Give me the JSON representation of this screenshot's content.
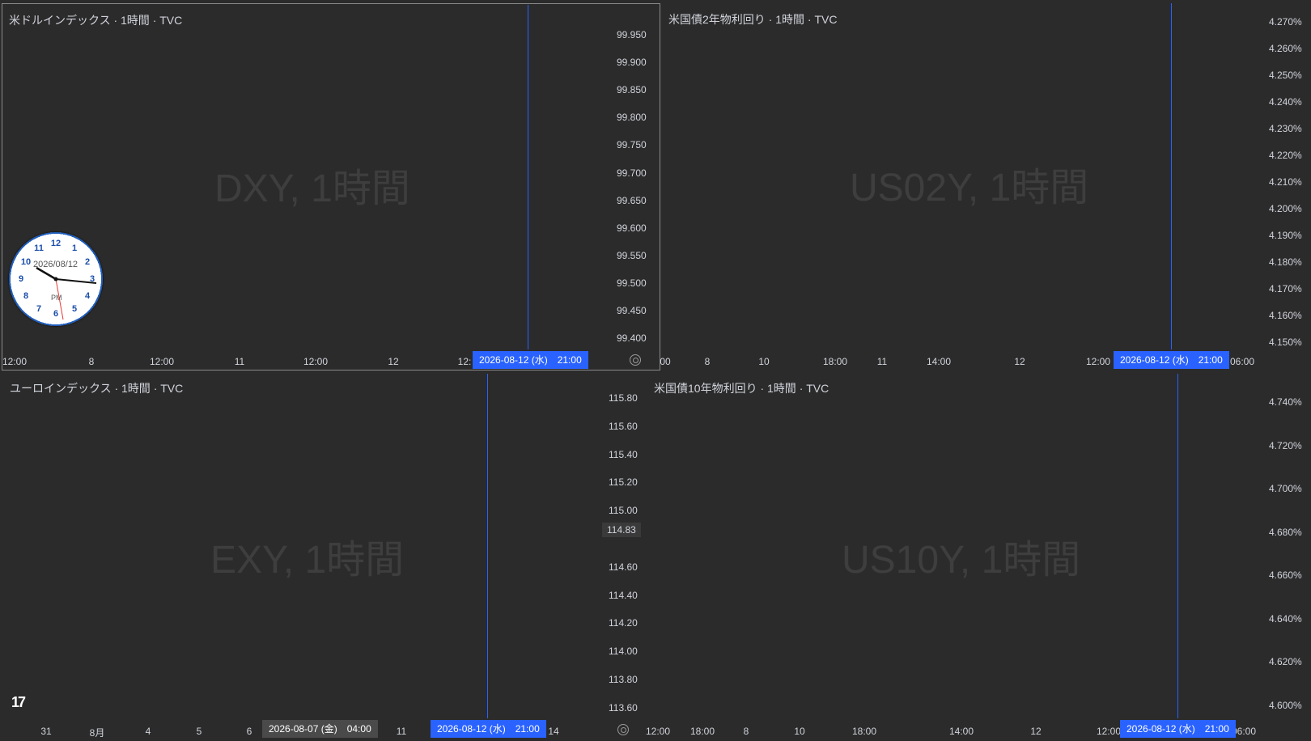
{
  "colors": {
    "up": "#089981",
    "down": "#ffffff",
    "crosshair": "#2962ff"
  },
  "panes": [
    {
      "id": "dxy",
      "title": "米ドルインデックス · 1時間 · TVC",
      "watermark": "DXY, 1時間",
      "y_ticks": [
        "99.950",
        "99.900",
        "99.850",
        "99.800",
        "99.750",
        "99.700",
        "99.650",
        "99.600",
        "99.550",
        "99.500",
        "99.450",
        "99.400"
      ],
      "x_ticks": [
        "12:00",
        "8",
        "12:00",
        "11",
        "12:00",
        "12",
        "12:"
      ],
      "time_badge": "2026-08-12 (水)　21:00",
      "clock": {
        "date": "2026/08/12",
        "ampm": "PM"
      }
    },
    {
      "id": "us02y",
      "title": "米国債2年物利回り · 1時間 · TVC",
      "watermark": "US02Y, 1時間",
      "y_ticks": [
        "4.270%",
        "4.260%",
        "4.250%",
        "4.240%",
        "4.230%",
        "4.220%",
        "4.210%",
        "4.200%",
        "4.190%",
        "4.180%",
        "4.170%",
        "4.160%",
        "4.150%"
      ],
      "x_ticks": [
        "00",
        "8",
        "10",
        "18:00",
        "11",
        "14:00",
        "12",
        "12:00",
        "06:00"
      ],
      "time_badge": "2026-08-12 (水)　21:00"
    },
    {
      "id": "exy",
      "title": "ユーロインデックス · 1時間 · TVC",
      "watermark": "EXY, 1時間",
      "y_ticks": [
        "115.80",
        "115.60",
        "115.40",
        "115.20",
        "115.00",
        "114.60",
        "114.40",
        "114.20",
        "114.00",
        "113.80",
        "113.60"
      ],
      "price_badge": "114.83",
      "x_ticks": [
        "31",
        "8月",
        "4",
        "5",
        "6",
        "11",
        "14"
      ],
      "time_badge_gray": "2026-08-07 (金)　04:00",
      "time_badge": "2026-08-12 (水)　21:00"
    },
    {
      "id": "us10y",
      "title": "米国債10年物利回り · 1時間 · TVC",
      "watermark": "US10Y, 1時間",
      "y_ticks": [
        "4.740%",
        "4.720%",
        "4.700%",
        "4.680%",
        "4.660%",
        "4.640%",
        "4.620%",
        "4.600%"
      ],
      "x_ticks": [
        "12:00",
        "18:00",
        "8",
        "10",
        "18:00",
        "14:00",
        "12",
        "12:00",
        "06:00"
      ],
      "time_badge": "2026-08-12 (水)　21:00"
    }
  ]
}
